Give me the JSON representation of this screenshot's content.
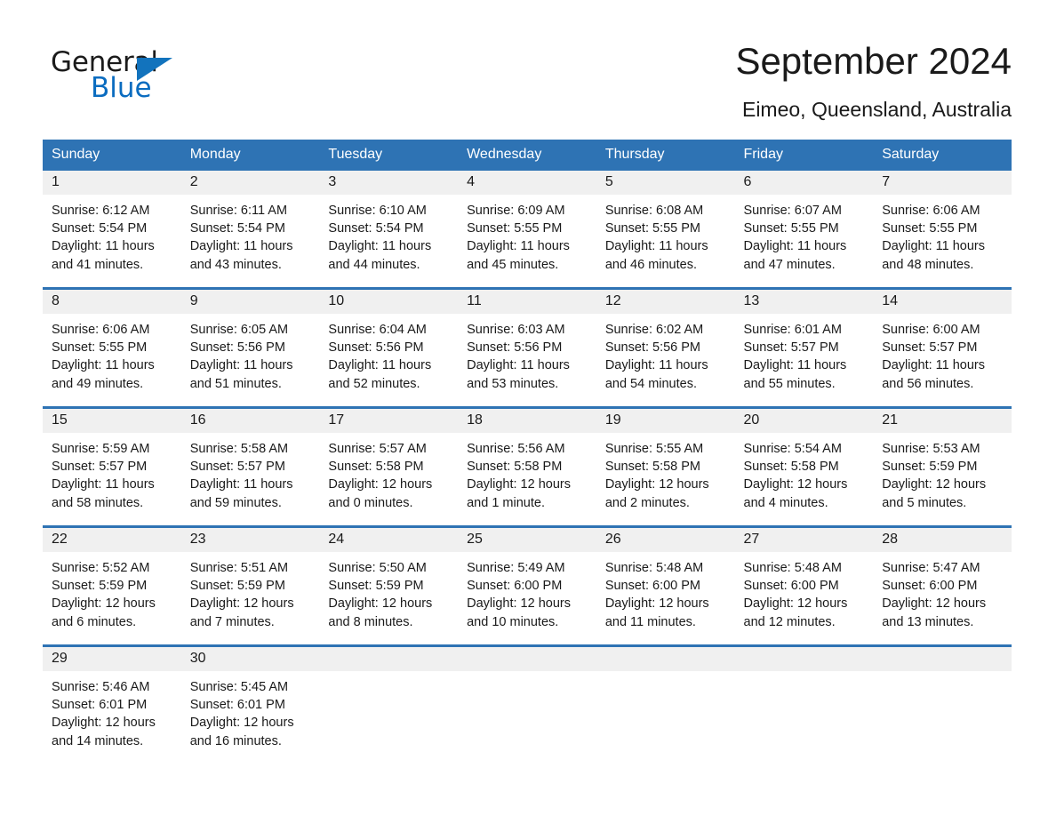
{
  "brand": {
    "name_part1": "General",
    "name_part2": "Blue",
    "accent_color": "#1273bd"
  },
  "header": {
    "title": "September 2024",
    "location": "Eimeo, Queensland, Australia"
  },
  "theme": {
    "header_blue": "#2e73b4",
    "daynum_band": "#f0f0f0",
    "text": "#1a1a1a"
  },
  "weekdays": [
    "Sunday",
    "Monday",
    "Tuesday",
    "Wednesday",
    "Thursday",
    "Friday",
    "Saturday"
  ],
  "weeks": [
    {
      "days": [
        {
          "day": "1",
          "sunrise": "Sunrise: 6:12 AM",
          "sunset": "Sunset: 5:54 PM",
          "daylight_1": "Daylight: 11 hours",
          "daylight_2": "and 41 minutes."
        },
        {
          "day": "2",
          "sunrise": "Sunrise: 6:11 AM",
          "sunset": "Sunset: 5:54 PM",
          "daylight_1": "Daylight: 11 hours",
          "daylight_2": "and 43 minutes."
        },
        {
          "day": "3",
          "sunrise": "Sunrise: 6:10 AM",
          "sunset": "Sunset: 5:54 PM",
          "daylight_1": "Daylight: 11 hours",
          "daylight_2": "and 44 minutes."
        },
        {
          "day": "4",
          "sunrise": "Sunrise: 6:09 AM",
          "sunset": "Sunset: 5:55 PM",
          "daylight_1": "Daylight: 11 hours",
          "daylight_2": "and 45 minutes."
        },
        {
          "day": "5",
          "sunrise": "Sunrise: 6:08 AM",
          "sunset": "Sunset: 5:55 PM",
          "daylight_1": "Daylight: 11 hours",
          "daylight_2": "and 46 minutes."
        },
        {
          "day": "6",
          "sunrise": "Sunrise: 6:07 AM",
          "sunset": "Sunset: 5:55 PM",
          "daylight_1": "Daylight: 11 hours",
          "daylight_2": "and 47 minutes."
        },
        {
          "day": "7",
          "sunrise": "Sunrise: 6:06 AM",
          "sunset": "Sunset: 5:55 PM",
          "daylight_1": "Daylight: 11 hours",
          "daylight_2": "and 48 minutes."
        }
      ]
    },
    {
      "days": [
        {
          "day": "8",
          "sunrise": "Sunrise: 6:06 AM",
          "sunset": "Sunset: 5:55 PM",
          "daylight_1": "Daylight: 11 hours",
          "daylight_2": "and 49 minutes."
        },
        {
          "day": "9",
          "sunrise": "Sunrise: 6:05 AM",
          "sunset": "Sunset: 5:56 PM",
          "daylight_1": "Daylight: 11 hours",
          "daylight_2": "and 51 minutes."
        },
        {
          "day": "10",
          "sunrise": "Sunrise: 6:04 AM",
          "sunset": "Sunset: 5:56 PM",
          "daylight_1": "Daylight: 11 hours",
          "daylight_2": "and 52 minutes."
        },
        {
          "day": "11",
          "sunrise": "Sunrise: 6:03 AM",
          "sunset": "Sunset: 5:56 PM",
          "daylight_1": "Daylight: 11 hours",
          "daylight_2": "and 53 minutes."
        },
        {
          "day": "12",
          "sunrise": "Sunrise: 6:02 AM",
          "sunset": "Sunset: 5:56 PM",
          "daylight_1": "Daylight: 11 hours",
          "daylight_2": "and 54 minutes."
        },
        {
          "day": "13",
          "sunrise": "Sunrise: 6:01 AM",
          "sunset": "Sunset: 5:57 PM",
          "daylight_1": "Daylight: 11 hours",
          "daylight_2": "and 55 minutes."
        },
        {
          "day": "14",
          "sunrise": "Sunrise: 6:00 AM",
          "sunset": "Sunset: 5:57 PM",
          "daylight_1": "Daylight: 11 hours",
          "daylight_2": "and 56 minutes."
        }
      ]
    },
    {
      "days": [
        {
          "day": "15",
          "sunrise": "Sunrise: 5:59 AM",
          "sunset": "Sunset: 5:57 PM",
          "daylight_1": "Daylight: 11 hours",
          "daylight_2": "and 58 minutes."
        },
        {
          "day": "16",
          "sunrise": "Sunrise: 5:58 AM",
          "sunset": "Sunset: 5:57 PM",
          "daylight_1": "Daylight: 11 hours",
          "daylight_2": "and 59 minutes."
        },
        {
          "day": "17",
          "sunrise": "Sunrise: 5:57 AM",
          "sunset": "Sunset: 5:58 PM",
          "daylight_1": "Daylight: 12 hours",
          "daylight_2": "and 0 minutes."
        },
        {
          "day": "18",
          "sunrise": "Sunrise: 5:56 AM",
          "sunset": "Sunset: 5:58 PM",
          "daylight_1": "Daylight: 12 hours",
          "daylight_2": "and 1 minute."
        },
        {
          "day": "19",
          "sunrise": "Sunrise: 5:55 AM",
          "sunset": "Sunset: 5:58 PM",
          "daylight_1": "Daylight: 12 hours",
          "daylight_2": "and 2 minutes."
        },
        {
          "day": "20",
          "sunrise": "Sunrise: 5:54 AM",
          "sunset": "Sunset: 5:58 PM",
          "daylight_1": "Daylight: 12 hours",
          "daylight_2": "and 4 minutes."
        },
        {
          "day": "21",
          "sunrise": "Sunrise: 5:53 AM",
          "sunset": "Sunset: 5:59 PM",
          "daylight_1": "Daylight: 12 hours",
          "daylight_2": "and 5 minutes."
        }
      ]
    },
    {
      "days": [
        {
          "day": "22",
          "sunrise": "Sunrise: 5:52 AM",
          "sunset": "Sunset: 5:59 PM",
          "daylight_1": "Daylight: 12 hours",
          "daylight_2": "and 6 minutes."
        },
        {
          "day": "23",
          "sunrise": "Sunrise: 5:51 AM",
          "sunset": "Sunset: 5:59 PM",
          "daylight_1": "Daylight: 12 hours",
          "daylight_2": "and 7 minutes."
        },
        {
          "day": "24",
          "sunrise": "Sunrise: 5:50 AM",
          "sunset": "Sunset: 5:59 PM",
          "daylight_1": "Daylight: 12 hours",
          "daylight_2": "and 8 minutes."
        },
        {
          "day": "25",
          "sunrise": "Sunrise: 5:49 AM",
          "sunset": "Sunset: 6:00 PM",
          "daylight_1": "Daylight: 12 hours",
          "daylight_2": "and 10 minutes."
        },
        {
          "day": "26",
          "sunrise": "Sunrise: 5:48 AM",
          "sunset": "Sunset: 6:00 PM",
          "daylight_1": "Daylight: 12 hours",
          "daylight_2": "and 11 minutes."
        },
        {
          "day": "27",
          "sunrise": "Sunrise: 5:48 AM",
          "sunset": "Sunset: 6:00 PM",
          "daylight_1": "Daylight: 12 hours",
          "daylight_2": "and 12 minutes."
        },
        {
          "day": "28",
          "sunrise": "Sunrise: 5:47 AM",
          "sunset": "Sunset: 6:00 PM",
          "daylight_1": "Daylight: 12 hours",
          "daylight_2": "and 13 minutes."
        }
      ]
    },
    {
      "days": [
        {
          "day": "29",
          "sunrise": "Sunrise: 5:46 AM",
          "sunset": "Sunset: 6:01 PM",
          "daylight_1": "Daylight: 12 hours",
          "daylight_2": "and 14 minutes."
        },
        {
          "day": "30",
          "sunrise": "Sunrise: 5:45 AM",
          "sunset": "Sunset: 6:01 PM",
          "daylight_1": "Daylight: 12 hours",
          "daylight_2": "and 16 minutes."
        },
        {
          "day": "",
          "sunrise": "",
          "sunset": "",
          "daylight_1": "",
          "daylight_2": ""
        },
        {
          "day": "",
          "sunrise": "",
          "sunset": "",
          "daylight_1": "",
          "daylight_2": ""
        },
        {
          "day": "",
          "sunrise": "",
          "sunset": "",
          "daylight_1": "",
          "daylight_2": ""
        },
        {
          "day": "",
          "sunrise": "",
          "sunset": "",
          "daylight_1": "",
          "daylight_2": ""
        },
        {
          "day": "",
          "sunrise": "",
          "sunset": "",
          "daylight_1": "",
          "daylight_2": ""
        }
      ]
    }
  ]
}
